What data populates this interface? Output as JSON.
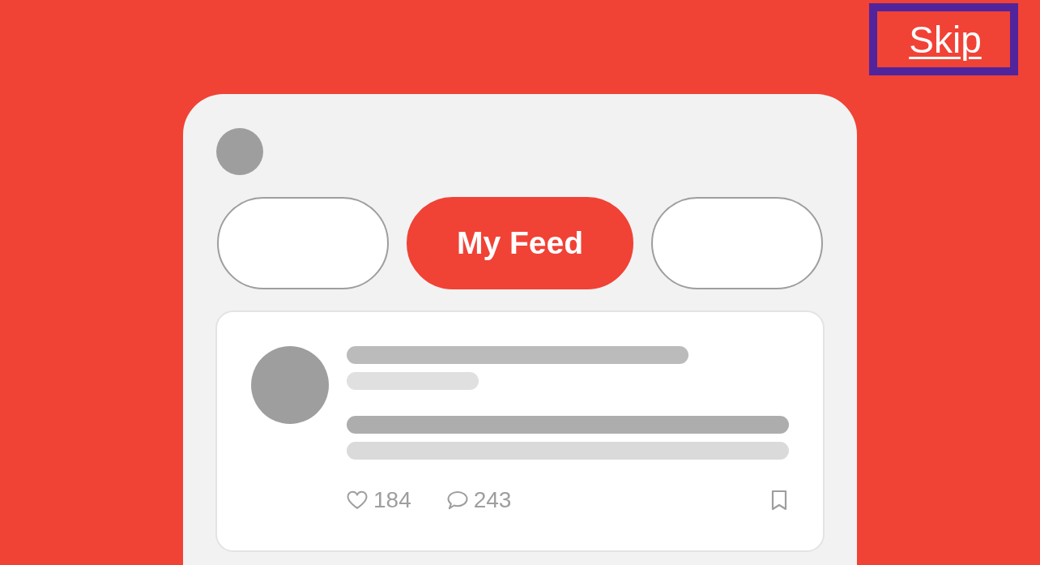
{
  "skip_link": {
    "label": "Skip",
    "focused": true
  },
  "tabs": [
    {
      "selected": false
    },
    {
      "label": "My Feed",
      "selected": true
    },
    {
      "selected": false
    }
  ],
  "post": {
    "likes": "184",
    "comments": "243"
  }
}
